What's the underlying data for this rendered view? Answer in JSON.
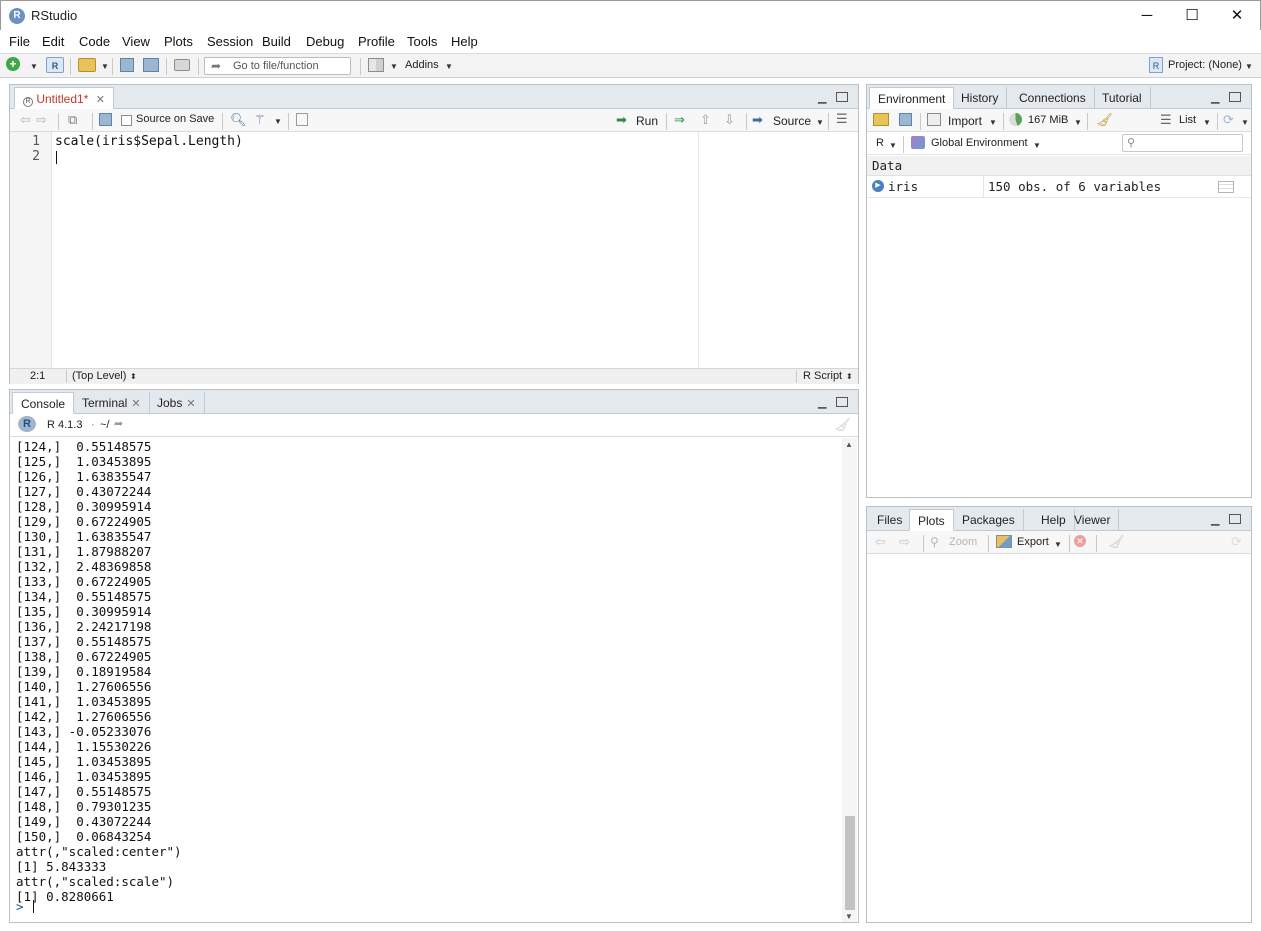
{
  "window": {
    "title": "RStudio",
    "logo_letter": "R",
    "minimize": "─",
    "maximize": "☐",
    "close": "✕"
  },
  "menu": [
    "File",
    "Edit",
    "Code",
    "View",
    "Plots",
    "Session",
    "Build",
    "Debug",
    "Profile",
    "Tools",
    "Help"
  ],
  "toolbar": {
    "goto_placeholder": "Go to file/function",
    "addins": "Addins",
    "project": "Project: (None)"
  },
  "editor": {
    "tab_label": "Untitled1*",
    "source_on_save": "Source on Save",
    "run": "Run",
    "source": "Source",
    "lines": [
      {
        "no": "1",
        "code": "scale(iris$Sepal.Length)"
      },
      {
        "no": "2",
        "code": ""
      }
    ],
    "cursor_pos": "2:1",
    "scope": "(Top Level)",
    "file_type": "R Script"
  },
  "console": {
    "tabs": [
      "Console",
      "Terminal",
      "Jobs"
    ],
    "r_version": "R 4.1.3",
    "wd": "~/",
    "lines": [
      "[124,]  0.55148575",
      "[125,]  1.03453895",
      "[126,]  1.63835547",
      "[127,]  0.43072244",
      "[128,]  0.30995914",
      "[129,]  0.67224905",
      "[130,]  1.63835547",
      "[131,]  1.87988207",
      "[132,]  2.48369858",
      "[133,]  0.67224905",
      "[134,]  0.55148575",
      "[135,]  0.30995914",
      "[136,]  2.24217198",
      "[137,]  0.55148575",
      "[138,]  0.67224905",
      "[139,]  0.18919584",
      "[140,]  1.27606556",
      "[141,]  1.03453895",
      "[142,]  1.27606556",
      "[143,] -0.05233076",
      "[144,]  1.15530226",
      "[145,]  1.03453895",
      "[146,]  1.03453895",
      "[147,]  0.55148575",
      "[148,]  0.79301235",
      "[149,]  0.43072244",
      "[150,]  0.06843254",
      "attr(,\"scaled:center\")",
      "[1] 5.843333",
      "attr(,\"scaled:scale\")",
      "[1] 0.8280661"
    ],
    "prompt": ">"
  },
  "environment": {
    "tabs": [
      "Environment",
      "History",
      "Connections",
      "Tutorial"
    ],
    "import": "Import",
    "memory": "167 MiB",
    "view_mode": "List",
    "language": "R",
    "scope": "Global Environment",
    "section": "Data",
    "rows": [
      {
        "name": "iris",
        "value": "150 obs. of 6 variables"
      }
    ]
  },
  "files_pane": {
    "tabs": [
      "Files",
      "Plots",
      "Packages",
      "Help",
      "Viewer"
    ],
    "zoom": "Zoom",
    "export": "Export"
  }
}
